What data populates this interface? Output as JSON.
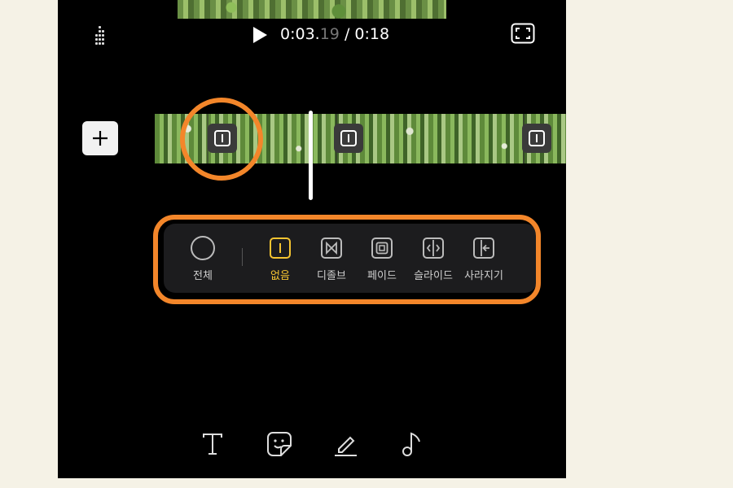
{
  "player": {
    "time_main": "0:03.",
    "time_frac": "19",
    "time_total": "/ 0:18",
    "icons": [
      "grid-menu-icon",
      "play-icon",
      "fullscreen-icon"
    ]
  },
  "timeline": {
    "add_label": "+",
    "transition_markers": 3
  },
  "transition_panel": {
    "options": [
      {
        "label": "전체",
        "icon": "circle-icon",
        "selected": false
      },
      {
        "label": "없음",
        "icon": "none-transition-icon",
        "selected": true
      },
      {
        "label": "디졸브",
        "icon": "dissolve-icon",
        "selected": false
      },
      {
        "label": "페이드",
        "icon": "fade-icon",
        "selected": false
      },
      {
        "label": "슬라이드",
        "icon": "slide-icon",
        "selected": false
      },
      {
        "label": "사라지기",
        "icon": "wipe-icon",
        "selected": false
      }
    ]
  },
  "bottom_tools": [
    "text-tool-icon",
    "sticker-icon",
    "draw-icon",
    "music-icon"
  ],
  "colors": {
    "highlight": "#f3862a",
    "selected": "#f5c431",
    "background": "#000000",
    "page_bg": "#f5f2e6"
  }
}
